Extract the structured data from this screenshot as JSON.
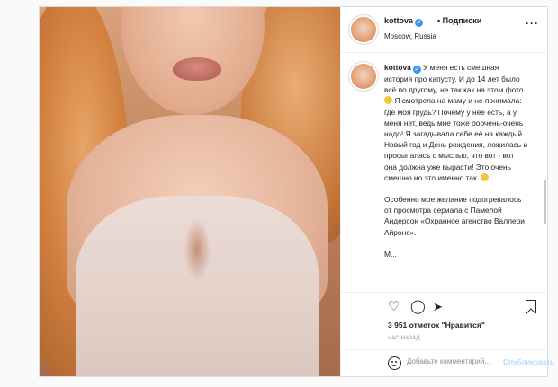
{
  "header": {
    "username": "kottova",
    "separator": "•",
    "follow_label": "Подписки",
    "location": "Moscow, Russia",
    "more_label": "···"
  },
  "caption": {
    "username": "kottova",
    "paragraph1_a": "У меня есть смешная история про капусту. И до 14 лет было всё по другому, не так как на этом фото.",
    "paragraph1_b": "Я смотрела на маму и не понимала: где моя грудь? Почему у неё есть, а у меня нет, ведь мне тоже ооочень-очень надо! Я загадывала себе её на каждый Новый год и День рождения, ложилась и просыпалась с мыслью, что вот - вот она должна уже вырасти! Это очень смешно но это именно так.",
    "paragraph2": "Особенно мое желание подогревалось от просмотра сериала с Памелой Андерсон «Охранное агенство Валлери Айронс».",
    "paragraph3_start": "М..."
  },
  "actions": {
    "likes_text": "3 951 отметок \"Нравится\"",
    "time_text": "час назад"
  },
  "comment_box": {
    "placeholder": "Добавьте комментарий...",
    "post_label": "Опубликовать"
  },
  "colors": {
    "accent": "#3897f0",
    "post_disabled": "#b3dbff",
    "text": "#262626",
    "muted": "#8e8e8e"
  },
  "icons": [
    "heart-icon",
    "comment-icon",
    "share-icon",
    "bookmark-icon",
    "emoji-icon",
    "verified-badge-icon",
    "more-options-icon"
  ]
}
